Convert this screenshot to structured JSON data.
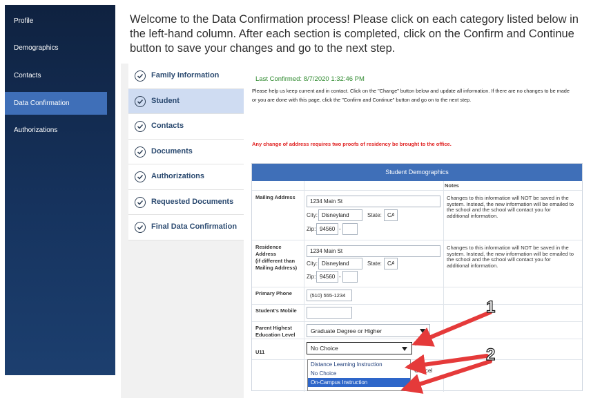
{
  "sidebar": {
    "items": [
      {
        "label": "Profile"
      },
      {
        "label": "Demographics"
      },
      {
        "label": "Contacts"
      },
      {
        "label": "Data Confirmation"
      },
      {
        "label": "Authorizations"
      }
    ],
    "active_index": 3
  },
  "welcome": "Welcome to the Data Confirmation process! Please click on each category listed below in the left-hand column. After each section is completed, click on the Confirm and Continue button to save your changes and go to the next step.",
  "steps": [
    {
      "label": "Family Information"
    },
    {
      "label": "Student"
    },
    {
      "label": "Contacts"
    },
    {
      "label": "Documents"
    },
    {
      "label": "Authorizations"
    },
    {
      "label": "Requested Documents"
    },
    {
      "label": "Final Data Confirmation"
    }
  ],
  "active_step": 1,
  "content": {
    "last_confirmed": "Last Confirmed: 8/7/2020 1:32:46 PM",
    "instructions": "Please help us keep current and in contact. Click on the \"Change\" button below and update all information. If there are no changes to be made or you are done with this page, click the \"Confirm and Continue\" button and go on to the next step.",
    "warning": "Any change of address requires two proofs of residency be brought to the office.",
    "table_title": "Student Demographics",
    "notes_header": "Notes",
    "mailing": {
      "label": "Mailing Address",
      "street": "1234 Main St",
      "city_label": "City:",
      "city": "Disneyland",
      "state_label": "State:",
      "state": "CA",
      "zip_label": "Zip:",
      "zip": "94560",
      "zip_ext": "",
      "note": "Changes to this information will NOT be saved in the system. Instead, the new information will be emailed to the school and the school will contact you for additional information."
    },
    "residence": {
      "label_l1": "Residence",
      "label_l2": "Address",
      "label_l3": "(if different than",
      "label_l4": "Mailing Address)",
      "street": "1234 Main St",
      "city_label": "City:",
      "city": "Disneyland",
      "state_label": "State:",
      "state": "CA",
      "zip_label": "Zip:",
      "zip": "94560",
      "zip_ext": "",
      "note": "Changes to this information will NOT be saved in the system. Instead, the new information will be emailed to the school and the school will contact you for additional information."
    },
    "primary_phone": {
      "label": "Primary Phone",
      "value": "(510) 555-1234"
    },
    "student_mobile": {
      "label": "Student's Mobile",
      "value": ""
    },
    "parent_education": {
      "label_l1": "Parent Highest",
      "label_l2": "Education Level",
      "value": "Graduate Degree or Higher"
    },
    "u11": {
      "label": "U11",
      "value": "No Choice"
    },
    "u11_options": [
      "Distance Learning Instruction",
      "No Choice",
      "On-Campus Instruction"
    ],
    "u11_highlighted": 2,
    "cancel_label": "Cancel"
  },
  "annotations": {
    "label_1": "1",
    "label_2": "2",
    "arrow_color": "#e53a3a"
  }
}
